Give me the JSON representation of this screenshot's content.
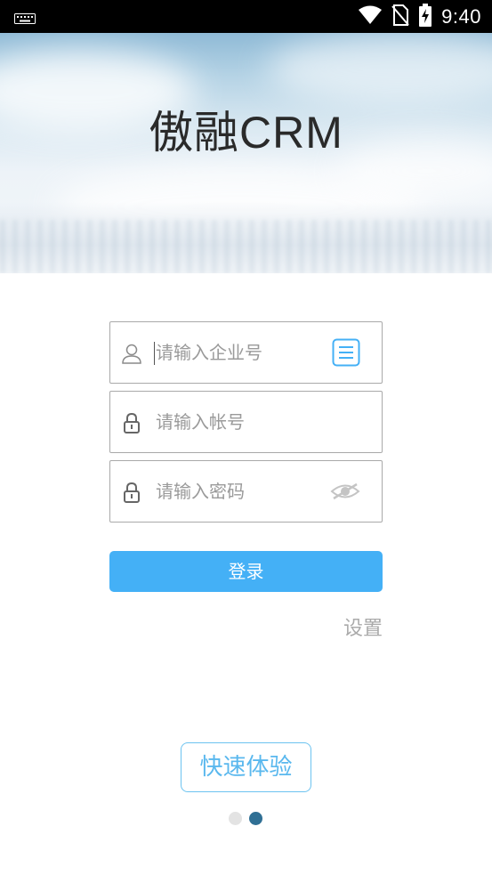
{
  "status_bar": {
    "time": "9:40",
    "icons": [
      "keyboard-icon",
      "wifi-icon",
      "no-sim-icon",
      "battery-charging-icon"
    ]
  },
  "banner": {
    "logo_text": "傲融CRM"
  },
  "form": {
    "company_field": {
      "placeholder": "请输入企业号",
      "lead_icon": "user-icon",
      "trail_icon": "list-icon"
    },
    "account_field": {
      "placeholder": "请输入帐号",
      "lead_icon": "lock-icon"
    },
    "password_field": {
      "placeholder": "请输入密码",
      "lead_icon": "lock-icon",
      "trail_icon": "eye-hidden-icon"
    },
    "login_label": "登录",
    "settings_label": "设置"
  },
  "quick_experience_label": "快速体验",
  "pager": {
    "count": 2,
    "active_index": 1
  },
  "colors": {
    "accent": "#44b0f6",
    "quick_border": "#6cc3f0",
    "dot_inactive": "#e3e3e3",
    "dot_active": "#2f6f94"
  }
}
